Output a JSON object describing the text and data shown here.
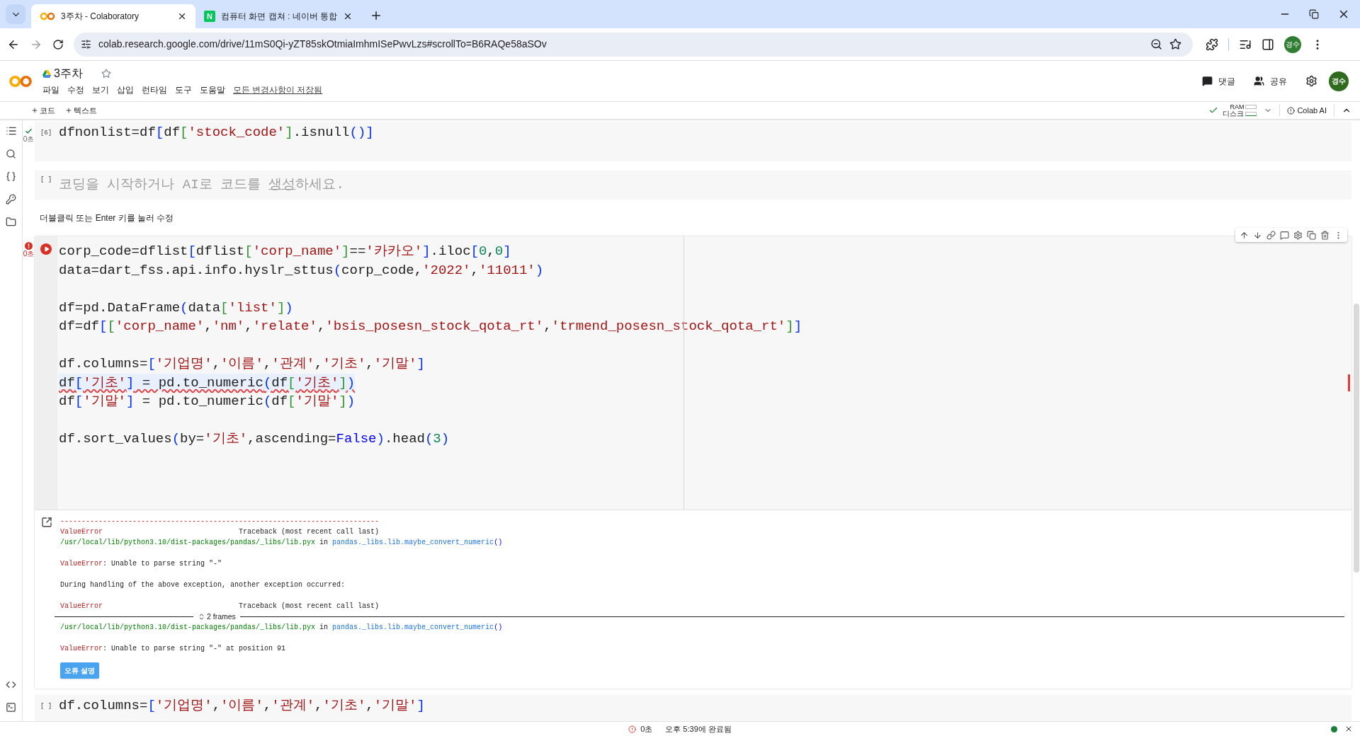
{
  "browser": {
    "tabs": [
      {
        "title": "3주차 - Colaboratory",
        "selected": true,
        "kind": "colab"
      },
      {
        "title": "컴퓨터 화면 캡쳐 : 네이버 통합",
        "selected": false,
        "kind": "naver",
        "icon_text": "N"
      }
    ],
    "url": "colab.research.google.com/drive/11mS0Qi-yZT85skOtmiaImhmISePwvLzs#scrollTo=B6RAQe58aSOv",
    "profile": "경수"
  },
  "header": {
    "title": "3주차",
    "menu": [
      "파일",
      "수정",
      "보기",
      "삽입",
      "런타임",
      "도구",
      "도움말"
    ],
    "save_status": "모든 변경사항이 저장됨",
    "actions": [
      "댓글",
      "공유"
    ],
    "avatar": "경수"
  },
  "toolbar": {
    "add_buttons": [
      "코드",
      "텍스트"
    ],
    "ram_label": "RAM",
    "disk_label": "디스크",
    "ai_button": "Colab AI"
  },
  "cells": [
    {
      "kind": "code",
      "exec_count": "[6]",
      "ran": true,
      "error": false,
      "time": "0초",
      "focused": false,
      "lines": [
        {
          "kind": "code",
          "flagged": false,
          "tokens": [
            {
              "kind": "t",
              "t": "dfnonlist=df"
            },
            {
              "kind": "b1",
              "t": "["
            },
            {
              "kind": "t",
              "t": "df"
            },
            {
              "kind": "b2",
              "t": "["
            },
            {
              "kind": "s",
              "t": "'stock_code'"
            },
            {
              "kind": "b2",
              "t": "]"
            },
            {
              "kind": "t",
              "t": ".isnull"
            },
            {
              "kind": "b1",
              "t": "("
            },
            {
              "kind": "b1",
              "t": ")"
            },
            {
              "kind": "b1",
              "t": "]"
            }
          ]
        }
      ]
    },
    {
      "kind": "empty",
      "exec_count": "[ ]",
      "before": "코딩을 시작하거나 AI로 코드를 ",
      "link": "생성",
      "after": "하세요."
    },
    {
      "kind": "hint",
      "text": "더블클릭 또는 Enter 키를 눌러 수정"
    },
    {
      "kind": "code",
      "ran": true,
      "error": true,
      "time": "0초",
      "focused": true,
      "lines": [
        {
          "kind": "code",
          "flagged": false,
          "tokens": [
            {
              "kind": "t",
              "t": "corp_code=dflist"
            },
            {
              "kind": "b1",
              "t": "["
            },
            {
              "kind": "t",
              "t": "dflist"
            },
            {
              "kind": "b2",
              "t": "["
            },
            {
              "kind": "s",
              "t": "'corp_name'"
            },
            {
              "kind": "b2",
              "t": "]"
            },
            {
              "kind": "t",
              "t": "=="
            },
            {
              "kind": "s",
              "t": "'카카오'"
            },
            {
              "kind": "b1",
              "t": "]"
            },
            {
              "kind": "t",
              "t": ".iloc"
            },
            {
              "kind": "b1",
              "t": "["
            },
            {
              "kind": "n",
              "t": "0"
            },
            {
              "kind": "t",
              "t": ","
            },
            {
              "kind": "n",
              "t": "0"
            },
            {
              "kind": "b1",
              "t": "]"
            }
          ]
        },
        {
          "kind": "code",
          "flagged": false,
          "tokens": [
            {
              "kind": "t",
              "t": "data=dart_fss.api.info.hyslr_sttus"
            },
            {
              "kind": "b1",
              "t": "("
            },
            {
              "kind": "t",
              "t": "corp_code,"
            },
            {
              "kind": "s",
              "t": "'2022'"
            },
            {
              "kind": "t",
              "t": ","
            },
            {
              "kind": "s",
              "t": "'11011'"
            },
            {
              "kind": "b1",
              "t": ")"
            }
          ]
        },
        {
          "kind": "blank"
        },
        {
          "kind": "code",
          "flagged": false,
          "tokens": [
            {
              "kind": "t",
              "t": "df=pd.DataFrame"
            },
            {
              "kind": "b1",
              "t": "("
            },
            {
              "kind": "t",
              "t": "data"
            },
            {
              "kind": "b2",
              "t": "["
            },
            {
              "kind": "s",
              "t": "'list'"
            },
            {
              "kind": "b2",
              "t": "]"
            },
            {
              "kind": "b1",
              "t": ")"
            }
          ]
        },
        {
          "kind": "code",
          "flagged": false,
          "tokens": [
            {
              "kind": "t",
              "t": "df=df"
            },
            {
              "kind": "b1",
              "t": "["
            },
            {
              "kind": "b2",
              "t": "["
            },
            {
              "kind": "s",
              "t": "'corp_name'"
            },
            {
              "kind": "t",
              "t": ","
            },
            {
              "kind": "s",
              "t": "'nm'"
            },
            {
              "kind": "t",
              "t": ","
            },
            {
              "kind": "s",
              "t": "'relate'"
            },
            {
              "kind": "t",
              "t": ","
            },
            {
              "kind": "s",
              "t": "'bsis_posesn_stock_qota_rt'"
            },
            {
              "kind": "t",
              "t": ","
            },
            {
              "kind": "s",
              "t": "'trmend_posesn_stock_qota_rt'"
            },
            {
              "kind": "b2",
              "t": "]"
            },
            {
              "kind": "b1",
              "t": "]"
            }
          ]
        },
        {
          "kind": "blank"
        },
        {
          "kind": "code",
          "flagged": false,
          "tokens": [
            {
              "kind": "t",
              "t": "df.columns="
            },
            {
              "kind": "b1",
              "t": "["
            },
            {
              "kind": "s",
              "t": "'기업명'"
            },
            {
              "kind": "t",
              "t": ","
            },
            {
              "kind": "s",
              "t": "'이름'"
            },
            {
              "kind": "t",
              "t": ","
            },
            {
              "kind": "s",
              "t": "'관계'"
            },
            {
              "kind": "t",
              "t": ","
            },
            {
              "kind": "s",
              "t": "'기초'"
            },
            {
              "kind": "t",
              "t": ","
            },
            {
              "kind": "s",
              "t": "'기말'"
            },
            {
              "kind": "b1",
              "t": "]"
            }
          ]
        },
        {
          "kind": "code",
          "flagged": true,
          "tokens": [
            {
              "kind": "t",
              "t": "df"
            },
            {
              "kind": "b1",
              "t": "["
            },
            {
              "kind": "s",
              "t": "'기초'"
            },
            {
              "kind": "b1",
              "t": "]"
            },
            {
              "kind": "t",
              "t": " = pd.to_numeric"
            },
            {
              "kind": "b1",
              "t": "("
            },
            {
              "kind": "t",
              "t": "df"
            },
            {
              "kind": "b2",
              "t": "["
            },
            {
              "kind": "s",
              "t": "'기초'"
            },
            {
              "kind": "b2",
              "t": "]"
            },
            {
              "kind": "b1",
              "t": ")"
            }
          ]
        },
        {
          "kind": "code",
          "flagged": false,
          "tokens": [
            {
              "kind": "t",
              "t": "df"
            },
            {
              "kind": "b1",
              "t": "["
            },
            {
              "kind": "s",
              "t": "'기말'"
            },
            {
              "kind": "b1",
              "t": "]"
            },
            {
              "kind": "t",
              "t": " = pd.to_numeric"
            },
            {
              "kind": "b1",
              "t": "("
            },
            {
              "kind": "t",
              "t": "df"
            },
            {
              "kind": "b2",
              "t": "["
            },
            {
              "kind": "s",
              "t": "'기말'"
            },
            {
              "kind": "b2",
              "t": "]"
            },
            {
              "kind": "b1",
              "t": ")"
            }
          ]
        },
        {
          "kind": "blank"
        },
        {
          "kind": "code",
          "flagged": false,
          "tokens": [
            {
              "kind": "t",
              "t": "df.sort_values"
            },
            {
              "kind": "b1",
              "t": "("
            },
            {
              "kind": "t",
              "t": "by="
            },
            {
              "kind": "s",
              "t": "'기초'"
            },
            {
              "kind": "t",
              "t": ",ascending="
            },
            {
              "kind": "kw",
              "t": "False"
            },
            {
              "kind": "b1",
              "t": ")"
            },
            {
              "kind": "t",
              "t": ".head"
            },
            {
              "kind": "b1",
              "t": "("
            },
            {
              "kind": "n",
              "t": "3"
            },
            {
              "kind": "b1",
              "t": ")"
            }
          ]
        }
      ],
      "output": {
        "lines": [
          {
            "kind": "text",
            "segs": [
              {
                "kind": "red",
                "t": "---------------------------------------------------------------------------"
              }
            ]
          },
          {
            "kind": "text",
            "segs": [
              {
                "kind": "red",
                "t": "ValueError"
              },
              {
                "kind": "plain",
                "t": "                                Traceback (most recent call last)"
              }
            ]
          },
          {
            "kind": "text",
            "segs": [
              {
                "kind": "green",
                "t": "/usr/local/lib/python3.10/dist-packages/pandas/_libs/lib.pyx"
              },
              {
                "kind": "plain",
                "t": " in "
              },
              {
                "kind": "blue",
                "t": "pandas._libs.lib.maybe_convert_numeric"
              },
              {
                "kind": "link",
                "t": "()"
              }
            ]
          },
          {
            "kind": "blank"
          },
          {
            "kind": "text",
            "segs": [
              {
                "kind": "red",
                "t": "ValueError"
              },
              {
                "kind": "plain",
                "t": ": Unable to parse string \"-\""
              }
            ]
          },
          {
            "kind": "blank"
          },
          {
            "kind": "text",
            "segs": [
              {
                "kind": "plain",
                "t": "During handling of the above exception, another exception occurred:"
              }
            ]
          },
          {
            "kind": "blank"
          },
          {
            "kind": "text",
            "segs": [
              {
                "kind": "red",
                "t": "ValueError"
              },
              {
                "kind": "plain",
                "t": "                                Traceback (most recent call last)"
              }
            ]
          },
          {
            "kind": "frames",
            "label": "2 frames"
          },
          {
            "kind": "text",
            "segs": [
              {
                "kind": "green",
                "t": "/usr/local/lib/python3.10/dist-packages/pandas/_libs/lib.pyx"
              },
              {
                "kind": "plain",
                "t": " in "
              },
              {
                "kind": "blue",
                "t": "pandas._libs.lib.maybe_convert_numeric"
              },
              {
                "kind": "link",
                "t": "()"
              }
            ]
          },
          {
            "kind": "blank"
          },
          {
            "kind": "text",
            "segs": [
              {
                "kind": "red",
                "t": "ValueError"
              },
              {
                "kind": "plain",
                "t": ": Unable to parse string \"-\" at position 91"
              }
            ]
          }
        ],
        "button": "오류 설명"
      }
    },
    {
      "kind": "code",
      "exec_count": "[ ]",
      "focused": false,
      "lines": [
        {
          "kind": "code",
          "flagged": false,
          "tokens": [
            {
              "kind": "t",
              "t": "df.columns="
            },
            {
              "kind": "b1",
              "t": "["
            },
            {
              "kind": "s",
              "t": "'기업명'"
            },
            {
              "kind": "t",
              "t": ","
            },
            {
              "kind": "s",
              "t": "'이름'"
            },
            {
              "kind": "t",
              "t": ","
            },
            {
              "kind": "s",
              "t": "'관계'"
            },
            {
              "kind": "t",
              "t": ","
            },
            {
              "kind": "s",
              "t": "'기초'"
            },
            {
              "kind": "t",
              "t": ","
            },
            {
              "kind": "s",
              "t": "'기말'"
            },
            {
              "kind": "b1",
              "t": "]"
            }
          ]
        }
      ]
    }
  ],
  "status_bar": {
    "elapsed": "0초",
    "completed": "오후 5:39에 완료됨"
  }
}
